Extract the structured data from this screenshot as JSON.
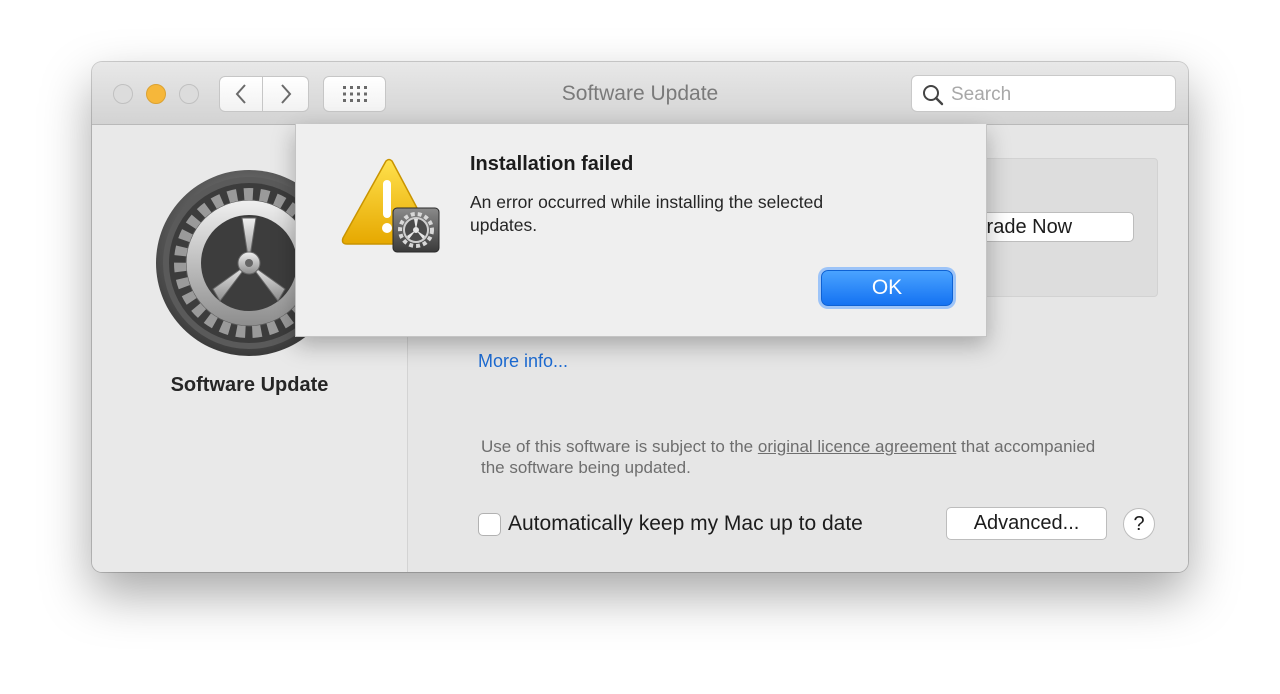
{
  "window": {
    "title": "Software Update"
  },
  "search": {
    "placeholder": "Search"
  },
  "sidebar": {
    "title": "Software Update"
  },
  "main": {
    "upgrade_button": "Upgrade Now",
    "more_info_link": "More info...",
    "licence_prefix": "Use of this software is subject to the ",
    "licence_link": "original licence agreement",
    "licence_suffix": " that accompanied the software being updated.",
    "auto_update_label": "Automatically keep my Mac up to date",
    "auto_update_checked": false,
    "advanced_button": "Advanced...",
    "help_button": "?"
  },
  "dialog": {
    "title": "Installation failed",
    "message": "An error occurred while installing the selected updates.",
    "ok_button": "OK",
    "icon": "warning-triangle-with-gear"
  },
  "colors": {
    "accent": "#1472f2",
    "link": "#1c6bd3",
    "minimize": "#f6b73a"
  },
  "icons": {
    "back": "chevron-left-icon",
    "forward": "chevron-right-icon",
    "show_all": "grid-icon",
    "search": "search-icon",
    "app": "gear-icon"
  }
}
